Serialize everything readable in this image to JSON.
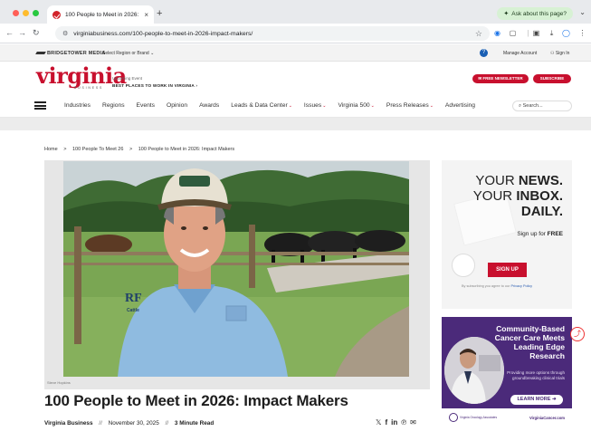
{
  "browser": {
    "tab_title": "100 People to Meet in 2026: I",
    "tab_close": "×",
    "new_tab": "+",
    "ask_label": "Ask about this page?",
    "url": "virginiabusiness.com/100-people-to-meet-in-2026-impact-makers/"
  },
  "utility": {
    "brand": "BRIDGETOWER MEDIA",
    "region_label": "Select Region or Brand",
    "manage_label": "Manage Account",
    "signin_label": "Sign In"
  },
  "header": {
    "logo": "virginia",
    "logo_sub": "BUSINESS",
    "upcoming_label": "Upcoming Event",
    "event_label": "BEST PLACES TO WORK IN VIRGINIA",
    "newsletter_btn": "FREE NEWSLETTER",
    "subscribe_btn": "SUBSCRIBE"
  },
  "nav": {
    "items": [
      {
        "label": "Industries",
        "caret": false
      },
      {
        "label": "Regions",
        "caret": false
      },
      {
        "label": "Events",
        "caret": false
      },
      {
        "label": "Opinion",
        "caret": false
      },
      {
        "label": "Awards",
        "caret": false
      },
      {
        "label": "Leads & Data Center",
        "caret": true
      },
      {
        "label": "Issues",
        "caret": true
      },
      {
        "label": "Virginia 500",
        "caret": true
      },
      {
        "label": "Press Releases",
        "caret": true
      },
      {
        "label": "Advertising",
        "caret": false
      }
    ],
    "search_placeholder": "Search..."
  },
  "breadcrumb": {
    "home": "Home",
    "parent": "100 People To Meet 26",
    "current": "100 People to Meet in 2026: Impact Makers",
    "sep": ">"
  },
  "article": {
    "photo_credit": "Steve Hopkins",
    "title": "100 People to Meet in 2026: Impact Makers",
    "publisher": "Virginia Business",
    "date": "November 30, 2025",
    "read_time": "3 Minute Read",
    "meta_sep": "//",
    "shirt_logo": "RF",
    "shirt_sub": "Cattle"
  },
  "share": {
    "x": "𝕏",
    "facebook": "f",
    "linkedin": "in",
    "pinterest": "℗",
    "email": "✉"
  },
  "ad_newsletter": {
    "line1_prefix": "YOUR ",
    "line1_bold": "NEWS.",
    "line2_prefix": "YOUR ",
    "line2_bold": "INBOX.",
    "line3": "DAILY.",
    "signup_prefix": "Sign up for ",
    "signup_bold": "FREE",
    "button": "SIGN UP",
    "fine_print": "By subscribing you agree to our ",
    "privacy": "Privacy Policy"
  },
  "ad_cancer": {
    "headline": "Community-Based Cancer Care Meets Leading Edge Research",
    "subtext": "Providing more options through groundbreaking clinical trials",
    "button": "LEARN MORE",
    "org": "Virginia Oncology Associates",
    "site": "VirginiaCancer.com"
  },
  "colors": {
    "brand_red": "#c8102e",
    "ad_purple": "#4b2a7a"
  }
}
